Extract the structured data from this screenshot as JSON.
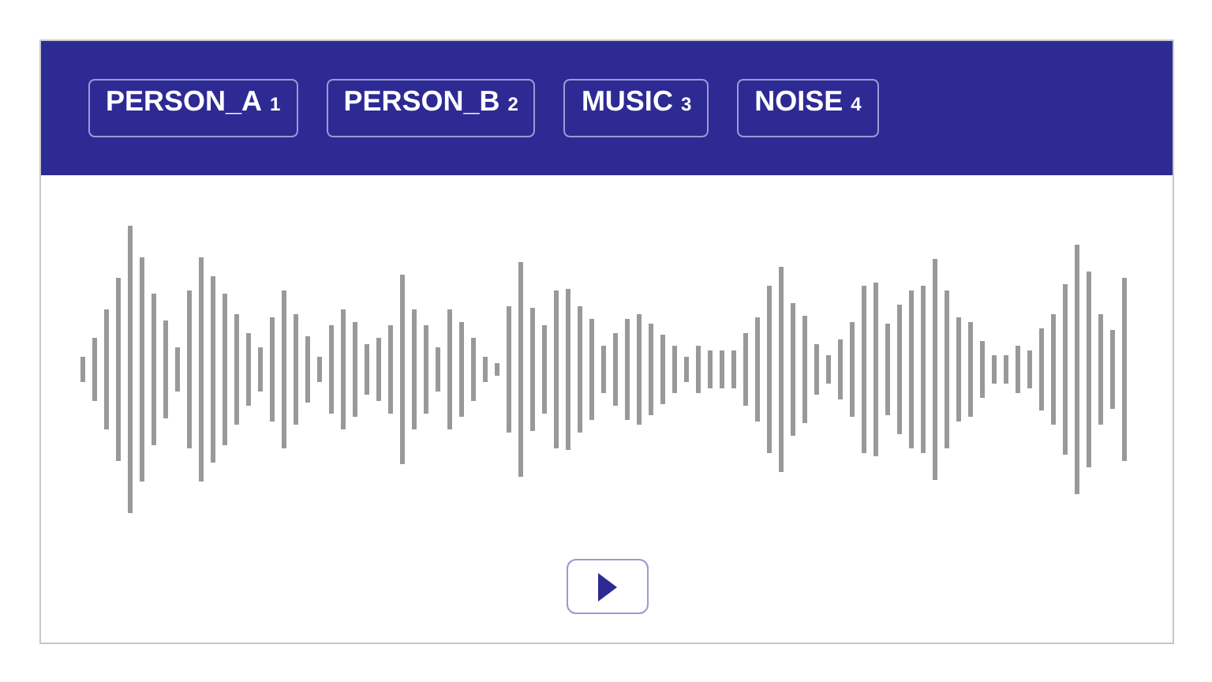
{
  "labels": [
    {
      "label": "PERSON_A",
      "shortcut": "1"
    },
    {
      "label": "PERSON_B",
      "shortcut": "2"
    },
    {
      "label": "MUSIC",
      "shortcut": "3"
    },
    {
      "label": "NOISE",
      "shortcut": "4"
    }
  ],
  "player": {
    "playing": false
  }
}
